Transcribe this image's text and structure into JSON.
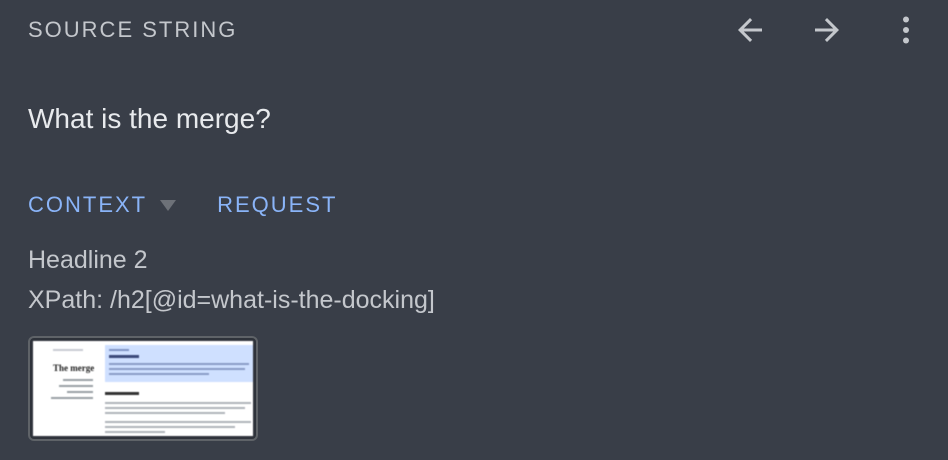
{
  "header": {
    "title": "SOURCE STRING",
    "back_icon": "arrow-left-icon",
    "forward_icon": "arrow-right-icon",
    "menu_icon": "more-vert-icon"
  },
  "source": {
    "text": "What is the merge?"
  },
  "tabs": [
    {
      "label": "CONTEXT",
      "has_dropdown": true
    },
    {
      "label": "REQUEST",
      "has_dropdown": false
    }
  ],
  "context": {
    "element_type": "Headline 2",
    "xpath": "XPath: /h2[@id=what-is-the-docking]",
    "screenshot_title": "The merge"
  },
  "colors": {
    "background": "#393e48",
    "accent": "#8ab4f8",
    "muted_text": "#c4c7cc"
  }
}
